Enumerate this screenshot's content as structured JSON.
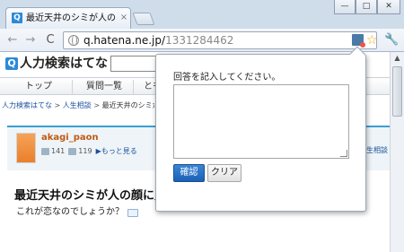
{
  "browser": {
    "tab": {
      "favicon": "Q",
      "title": "最近天井のシミが人の顔に",
      "close": "×"
    },
    "window_buttons": [
      "—",
      "□",
      "✕"
    ],
    "nav": {
      "back": "←",
      "forward": "→",
      "reload": "C"
    },
    "address": {
      "host": "q.hatena.ne.jp/",
      "path": "1331284462"
    },
    "star": "☆",
    "wrench": "🔧"
  },
  "site": {
    "logo_mark": "Q",
    "logo_text": "人力検索はてな",
    "nav_items": [
      "トップ",
      "質問一覧",
      "とも"
    ],
    "breadcrumb": [
      "人力検索はてな",
      "人生相談",
      "最近天井のシミが人の"
    ]
  },
  "user": {
    "name": "akagi_paon",
    "answers": "141",
    "questions": "119",
    "more": "▶もっと見る",
    "right_link": "人生相談"
  },
  "question": {
    "title": "最近天井のシミが人の顔に見え",
    "sub": "これが恋なのでしょうか？"
  },
  "popup": {
    "label": "回答を記入してください。",
    "textarea_value": "",
    "confirm": "確認",
    "clear": "クリア"
  }
}
